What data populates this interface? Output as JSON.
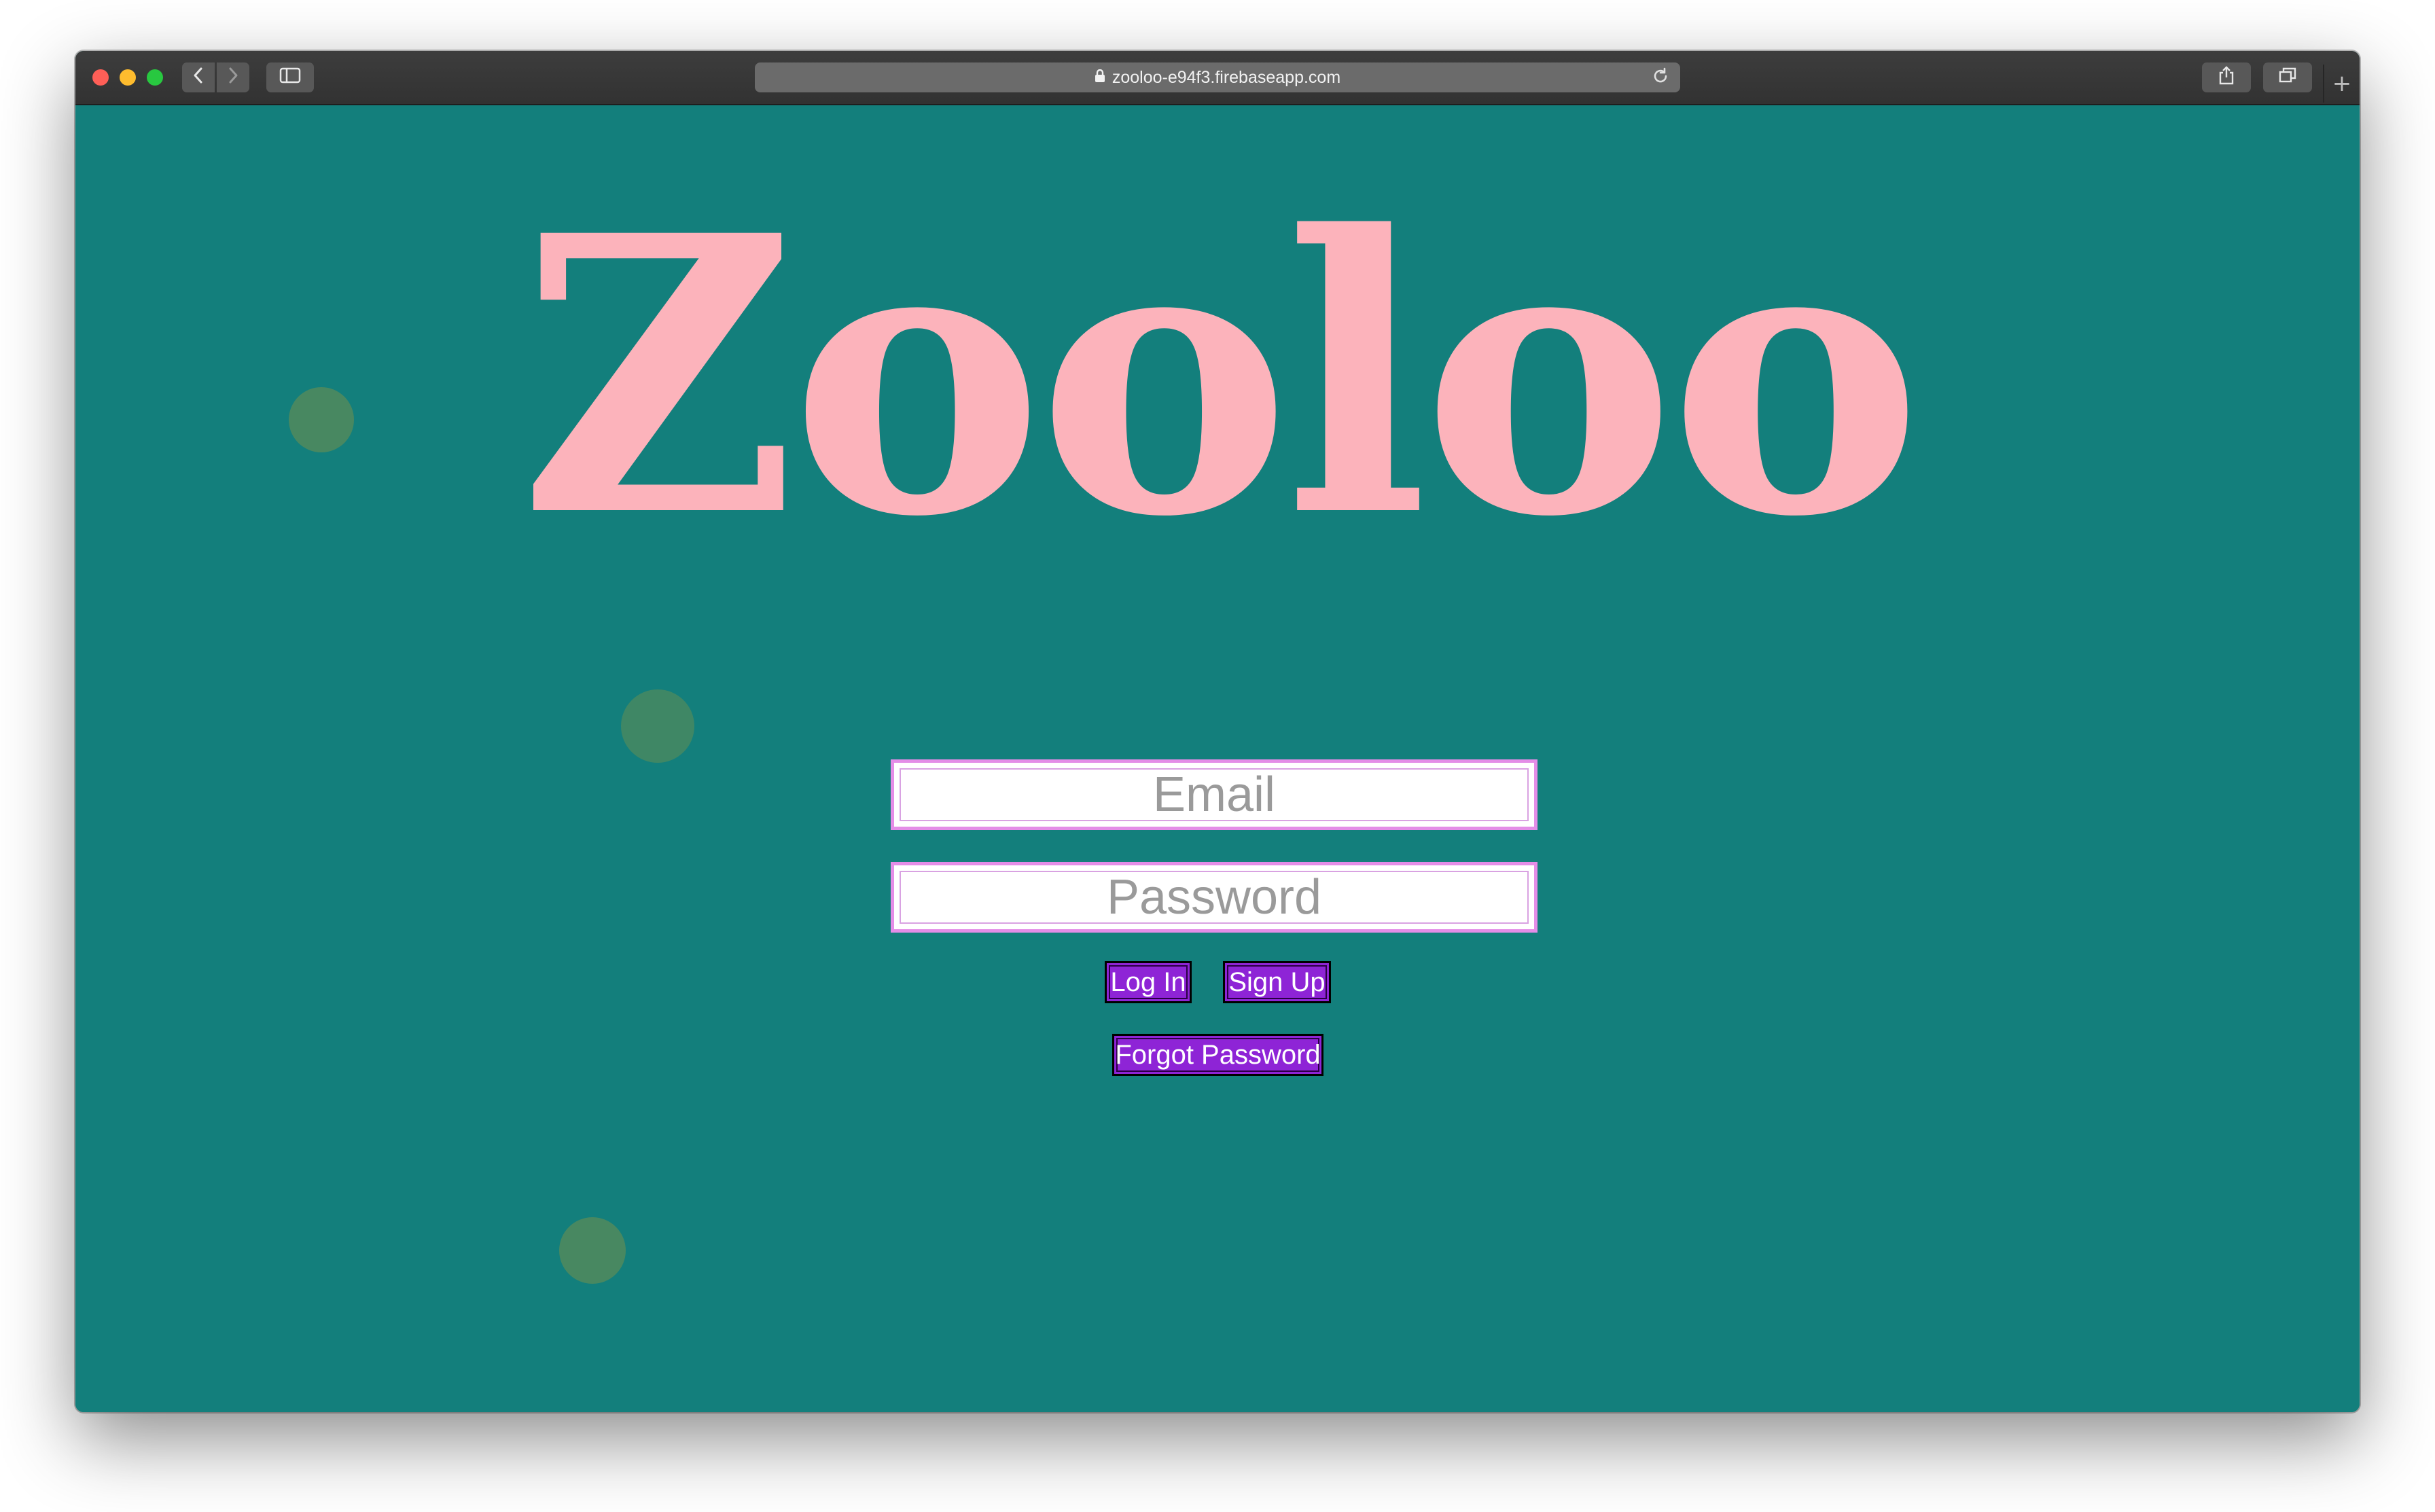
{
  "browser": {
    "url": "zooloo-e94f3.firebaseapp.com",
    "icons": {
      "back": "chevron-left-icon",
      "forward": "chevron-right-icon",
      "sidebar": "sidebar-icon",
      "lock": "lock-icon",
      "reload": "reload-icon",
      "share": "share-icon",
      "tabs": "tabs-icon",
      "new_tab": "plus-icon"
    }
  },
  "page": {
    "logo": "Zooloo",
    "email_placeholder": "Email",
    "password_placeholder": "Password",
    "login_label": "Log In",
    "signup_label": "Sign Up",
    "forgot_label": "Forgot Password"
  },
  "colors": {
    "background": "#137f7c",
    "logo": "#fcb3bb",
    "button": "#8e24d6",
    "field_border": "#e48de7",
    "dot": "#4f8a5e"
  }
}
